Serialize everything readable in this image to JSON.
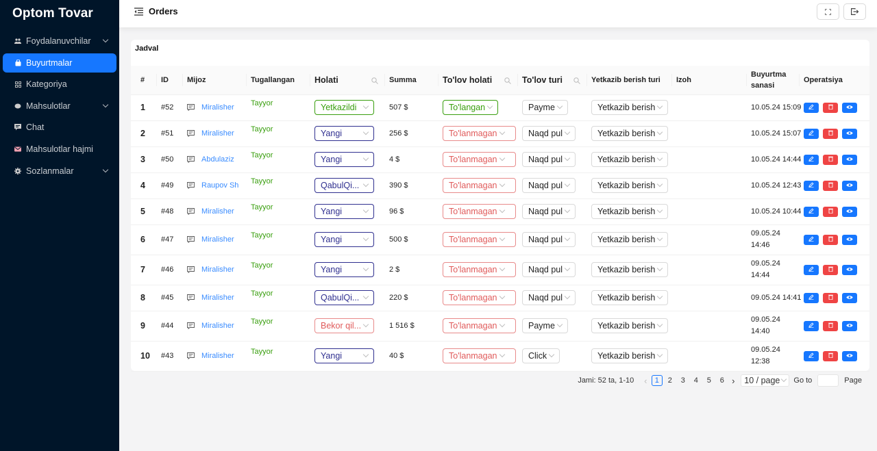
{
  "app": {
    "brand": "Optom Tovar"
  },
  "sidebar": {
    "items": [
      {
        "label": "Foydalanuvchilar",
        "icon": "users-icon",
        "expandable": true,
        "active": false
      },
      {
        "label": "Buyurtmalar",
        "icon": "shopping-bag-icon",
        "expandable": false,
        "active": true
      },
      {
        "label": "Kategoriya",
        "icon": "grid-icon",
        "expandable": false,
        "active": false
      },
      {
        "label": "Mahsulotlar",
        "icon": "box-icon",
        "expandable": true,
        "active": false
      },
      {
        "label": "Chat",
        "icon": "chat-icon",
        "expandable": false,
        "active": false
      },
      {
        "label": "Mahsulotlar hajmi",
        "icon": "mail-icon",
        "expandable": false,
        "active": false
      },
      {
        "label": "Sozlanmalar",
        "icon": "gear-icon",
        "expandable": true,
        "active": false
      }
    ]
  },
  "header": {
    "title": "Orders",
    "fullscreen_icon": "fullscreen-icon",
    "logout_icon": "logout-icon"
  },
  "card": {
    "title": "Jadval"
  },
  "table": {
    "headers": {
      "index": "#",
      "id": "ID",
      "customer": "Mijoz",
      "completed": "Tugallangan",
      "status": "Holati",
      "sum": "Summa",
      "payment_status": "To'lov holati",
      "payment_type": "To'lov turi",
      "delivery_type": "Yetkazib berish turi",
      "note": "Izoh",
      "order_date": "Buyurtma sanasi",
      "operations": "Operatsiya"
    },
    "rows": [
      {
        "n": "1",
        "id": "#52",
        "customer": "Miralisher",
        "completed": "Tayyor",
        "status": "Yetkazildi",
        "status_tone": "green",
        "sum": "507 $",
        "pay_status": "To'langan",
        "pay_tone": "green",
        "pay_type": "Payme",
        "delivery": "Yetkazib berish",
        "note": "",
        "date": "10.05.24 15:09"
      },
      {
        "n": "2",
        "id": "#51",
        "customer": "Miralisher",
        "completed": "Tayyor",
        "status": "Yangi",
        "status_tone": "navy",
        "sum": "256 $",
        "pay_status": "To'lanmagan",
        "pay_tone": "red",
        "pay_type": "Naqd pul",
        "delivery": "Yetkazib berish",
        "note": "",
        "date": "10.05.24 15:07"
      },
      {
        "n": "3",
        "id": "#50",
        "customer": "Abdulaziz",
        "completed": "Tayyor",
        "status": "Yangi",
        "status_tone": "navy",
        "sum": "4 $",
        "pay_status": "To'lanmagan",
        "pay_tone": "red",
        "pay_type": "Naqd pul",
        "delivery": "Yetkazib berish",
        "note": "",
        "date": "10.05.24 14:44"
      },
      {
        "n": "4",
        "id": "#49",
        "customer": "Raupov Sh",
        "completed": "Tayyor",
        "status": "QabulQi...",
        "status_tone": "navy",
        "sum": "390 $",
        "pay_status": "To'lanmagan",
        "pay_tone": "red",
        "pay_type": "Naqd pul",
        "delivery": "Yetkazib berish",
        "note": "",
        "date": "10.05.24 12:43"
      },
      {
        "n": "5",
        "id": "#48",
        "customer": "Miralisher",
        "completed": "Tayyor",
        "status": "Yangi",
        "status_tone": "navy",
        "sum": "96 $",
        "pay_status": "To'lanmagan",
        "pay_tone": "red",
        "pay_type": "Naqd pul",
        "delivery": "Yetkazib berish",
        "note": "",
        "date": "10.05.24 10:44"
      },
      {
        "n": "6",
        "id": "#47",
        "customer": "Miralisher",
        "completed": "Tayyor",
        "status": "Yangi",
        "status_tone": "navy",
        "sum": "500 $",
        "pay_status": "To'lanmagan",
        "pay_tone": "red",
        "pay_type": "Naqd pul",
        "delivery": "Yetkazib berish",
        "note": "",
        "date": "09.05.24 14:46"
      },
      {
        "n": "7",
        "id": "#46",
        "customer": "Miralisher",
        "completed": "Tayyor",
        "status": "Yangi",
        "status_tone": "navy",
        "sum": "2 $",
        "pay_status": "To'lanmagan",
        "pay_tone": "red",
        "pay_type": "Naqd pul",
        "delivery": "Yetkazib berish",
        "note": "",
        "date": "09.05.24 14:44"
      },
      {
        "n": "8",
        "id": "#45",
        "customer": "Miralisher",
        "completed": "Tayyor",
        "status": "QabulQi...",
        "status_tone": "navy",
        "sum": "220 $",
        "pay_status": "To'lanmagan",
        "pay_tone": "red",
        "pay_type": "Naqd pul",
        "delivery": "Yetkazib berish",
        "note": "",
        "date": "09.05.24 14:41"
      },
      {
        "n": "9",
        "id": "#44",
        "customer": "Miralisher",
        "completed": "Tayyor",
        "status": "Bekor qil...",
        "status_tone": "red",
        "sum": "1 516 $",
        "pay_status": "To'lanmagan",
        "pay_tone": "red",
        "pay_type": "Payme",
        "delivery": "Yetkazib berish",
        "note": "",
        "date": "09.05.24 14:40"
      },
      {
        "n": "10",
        "id": "#43",
        "customer": "Miralisher",
        "completed": "Tayyor",
        "status": "Yangi",
        "status_tone": "navy",
        "sum": "40 $",
        "pay_status": "To'lanmagan",
        "pay_tone": "red",
        "pay_type": "Click",
        "delivery": "Yetkazib berish",
        "note": "",
        "date": "09.05.24 12:38"
      }
    ]
  },
  "pagination": {
    "total_label": "Jami: 52 ta, 1-10",
    "pages": [
      "1",
      "2",
      "3",
      "4",
      "5",
      "6"
    ],
    "current": "1",
    "page_size": "10 / page",
    "goto_label": "Go to",
    "goto_value": "",
    "page_label": "Page"
  },
  "colors": {
    "sidebar_bg": "#001529",
    "accent": "#1677ff",
    "success": "#389e0d",
    "danger": "#ef4444",
    "navy": "#2f2f8f"
  }
}
